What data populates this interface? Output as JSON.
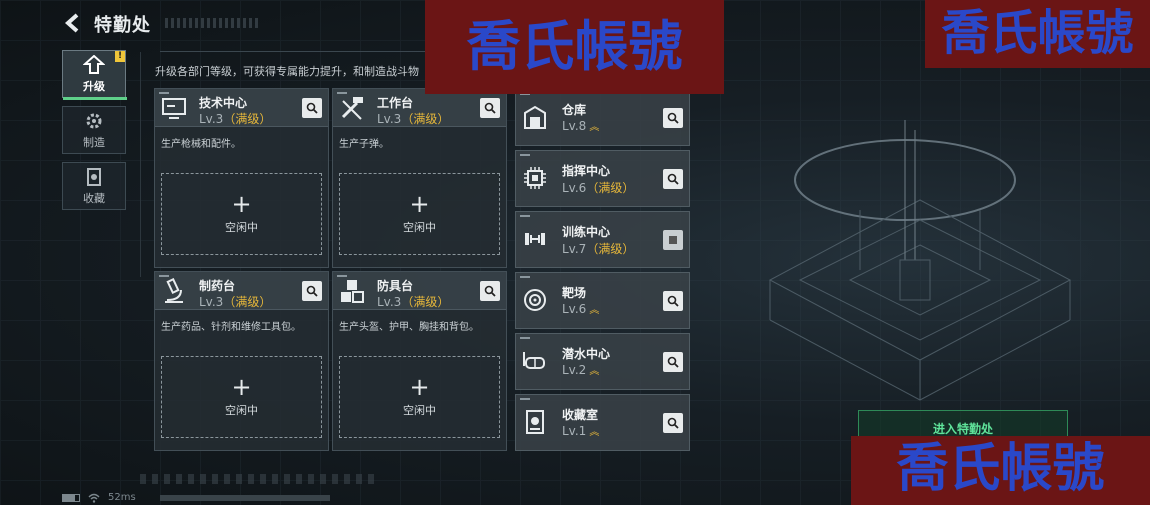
{
  "header": {
    "title": "特勤处"
  },
  "nav": [
    {
      "label": "升级",
      "icon": "upgrade-icon",
      "badge": "!"
    },
    {
      "label": "制造",
      "icon": "gear-icon"
    },
    {
      "label": "收藏",
      "icon": "collection-icon"
    }
  ],
  "description": "升级各部门等级，可获得专属能力提升，和制造战斗物",
  "cards": [
    {
      "name": "技术中心",
      "level": "Lv.3",
      "tag": "（满级）",
      "desc": "生产枪械和配件。",
      "slot_plus": "+",
      "slot_status": "空闲中",
      "icon": "monitor-icon"
    },
    {
      "name": "工作台",
      "level": "Lv.3",
      "tag": "（满级）",
      "desc": "生产子弹。",
      "slot_plus": "+",
      "slot_status": "空闲中",
      "icon": "tools-icon"
    },
    {
      "name": "制药台",
      "level": "Lv.3",
      "tag": "（满级）",
      "desc": "生产药品、针剂和维修工具包。",
      "slot_plus": "+",
      "slot_status": "空闲中",
      "icon": "microscope-icon"
    },
    {
      "name": "防具台",
      "level": "Lv.3",
      "tag": "（满级）",
      "desc": "生产头盔、护甲、胸挂和背包。",
      "slot_plus": "+",
      "slot_status": "空闲中",
      "icon": "boxes-icon"
    }
  ],
  "facilities": [
    {
      "name": "仓库",
      "level": "Lv.8",
      "tag": "",
      "icon": "warehouse-icon"
    },
    {
      "name": "指挥中心",
      "level": "Lv.6",
      "tag": "（满级）",
      "icon": "chip-icon"
    },
    {
      "name": "训练中心",
      "level": "Lv.7",
      "tag": "（满级）",
      "icon": "dumbbell-icon"
    },
    {
      "name": "靶场",
      "level": "Lv.6",
      "tag": "",
      "icon": "target-icon"
    },
    {
      "name": "潜水中心",
      "level": "Lv.2",
      "tag": "",
      "icon": "diving-mask-icon"
    },
    {
      "name": "收藏室",
      "level": "Lv.1",
      "tag": "",
      "icon": "collection-room-icon"
    }
  ],
  "enter_button": "进入特勤处",
  "watermark": "喬氏帳號",
  "status": {
    "ping": "52ms"
  },
  "colors": {
    "accent_green": "#5fd08a",
    "max_level": "#e6b73a",
    "watermark_bg": "#6b1515",
    "watermark_text": "#2a48c9"
  }
}
